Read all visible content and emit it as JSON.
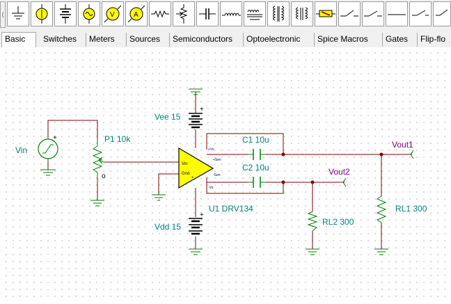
{
  "toolbar": {
    "scroll_left_glyph": "⟨",
    "buttons": [
      {
        "name": "ground-icon"
      },
      {
        "name": "voltage-source-icon"
      },
      {
        "name": "battery-icon"
      },
      {
        "name": "ac-source-icon"
      },
      {
        "name": "voltmeter-icon"
      },
      {
        "name": "ammeter-icon"
      },
      {
        "name": "resistor-icon"
      },
      {
        "name": "potentiometer-icon"
      },
      {
        "name": "capacitor-icon"
      },
      {
        "name": "inductor-icon"
      },
      {
        "name": "transformer-icon"
      },
      {
        "name": "coupled-inductor-icon"
      },
      {
        "name": "relay-icon"
      },
      {
        "name": "lamp-icon"
      },
      {
        "name": "switch-icon"
      }
    ]
  },
  "tabs": [
    {
      "label": "Basic",
      "active": true
    },
    {
      "label": "Switches",
      "active": false
    },
    {
      "label": "Meters",
      "active": false
    },
    {
      "label": "Sources",
      "active": false
    },
    {
      "label": "Semiconductors",
      "active": false
    },
    {
      "label": "Optoelectronic",
      "active": false
    },
    {
      "label": "Spice Macros",
      "active": false
    },
    {
      "label": "Gates",
      "active": false
    },
    {
      "label": "Flip-flo",
      "active": false
    }
  ],
  "schematic": {
    "vin_label": "Vin",
    "vin_plus": "+",
    "p1_label": "P1 10k",
    "p1_wiper": "o",
    "vee_label": "Vee 15",
    "vee_plus": "+",
    "vdd_label": "Vdd 15",
    "vdd_plus": "+",
    "u1_label": "U1 DRV134",
    "c1_label": "C1 10u",
    "c2_label": "C2 10u",
    "vout1_label": "Vout1",
    "vout2_label": "Vout2",
    "rl1_label": "RL1 300",
    "rl2_label": "RL2 300",
    "pins": {
      "vin": "Vin",
      "gnd": "Gnd",
      "plus": "+",
      "pvo": "+Vo",
      "psen": "+Sen",
      "nsen": "-Sen",
      "nvo": "-Vo"
    },
    "colors": {
      "wire": "#800000",
      "label": "#008080",
      "net_label": "#800080",
      "opamp_fill": "#ffff00",
      "dot": "#800000"
    }
  }
}
